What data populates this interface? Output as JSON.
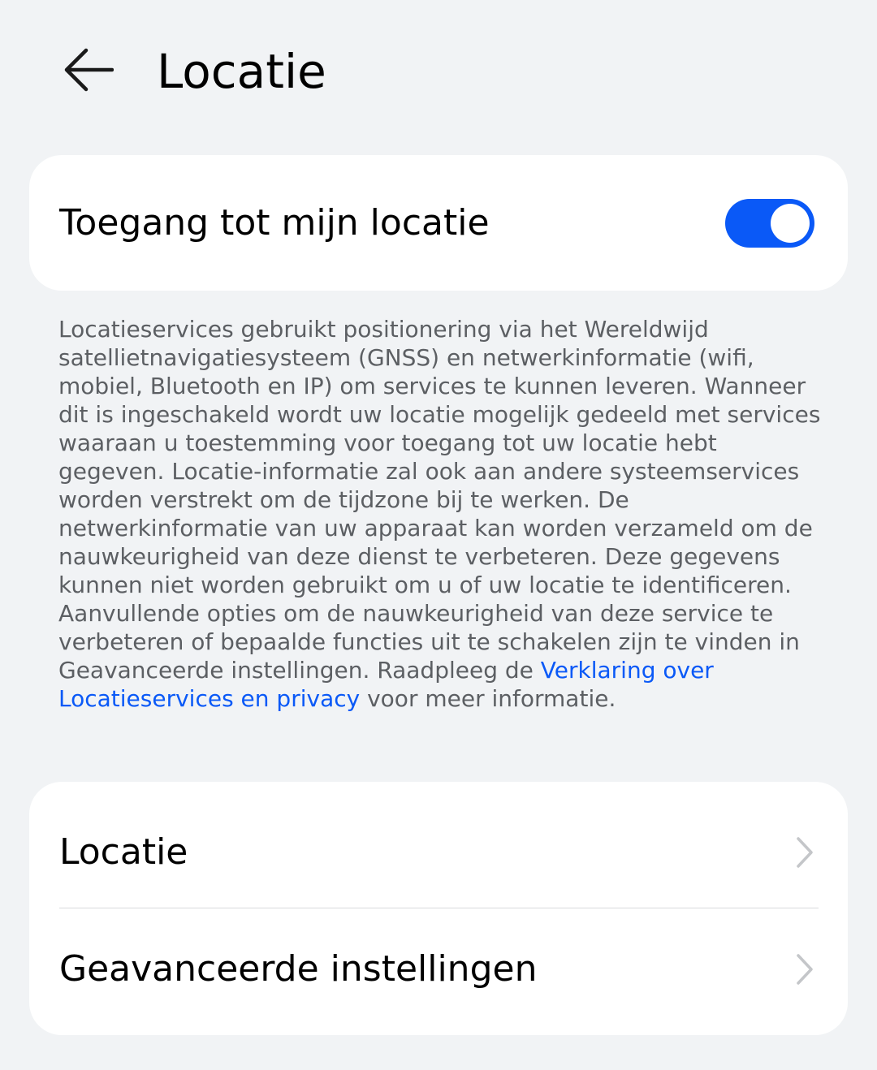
{
  "header": {
    "back_icon": "arrow-left-icon",
    "title": "Locatie"
  },
  "access_card": {
    "label": "Toegang tot mijn locatie",
    "toggle_on": true,
    "toggle_color": "#0a59f7"
  },
  "description": {
    "text_before_link": "Locatieservices gebruikt positionering via het Wereldwijd satellietnavigatiesysteem (GNSS) en netwerkinformatie (wifi, mobiel, Bluetooth en IP) om services te kunnen leveren. Wanneer dit is ingeschakeld wordt uw locatie mogelijk gedeeld met services waaraan u toestemming voor toegang tot uw locatie hebt gegeven. Locatie-informatie zal ook aan andere systeemservices worden verstrekt om de tijdzone bij te werken. De netwerkinformatie van uw apparaat kan worden verzameld om de nauwkeurigheid van deze dienst te verbeteren. Deze gegevens kunnen niet worden gebruikt om u of uw locatie te identificeren. Aanvullende opties om de nauwkeurigheid van deze service te verbeteren of bepaalde functies uit te schakelen zijn te vinden in Geavanceerde instellingen. Raadpleeg de",
    "link_text": "Verklaring over Locatieservices en privacy",
    "text_after_link": "voor meer informatie.",
    "link_color": "#0a59f7"
  },
  "settings_list": {
    "items": [
      {
        "label": "Locatie",
        "icon": "chevron-right-icon"
      },
      {
        "label": "Geavanceerde instellingen",
        "icon": "chevron-right-icon"
      }
    ]
  }
}
